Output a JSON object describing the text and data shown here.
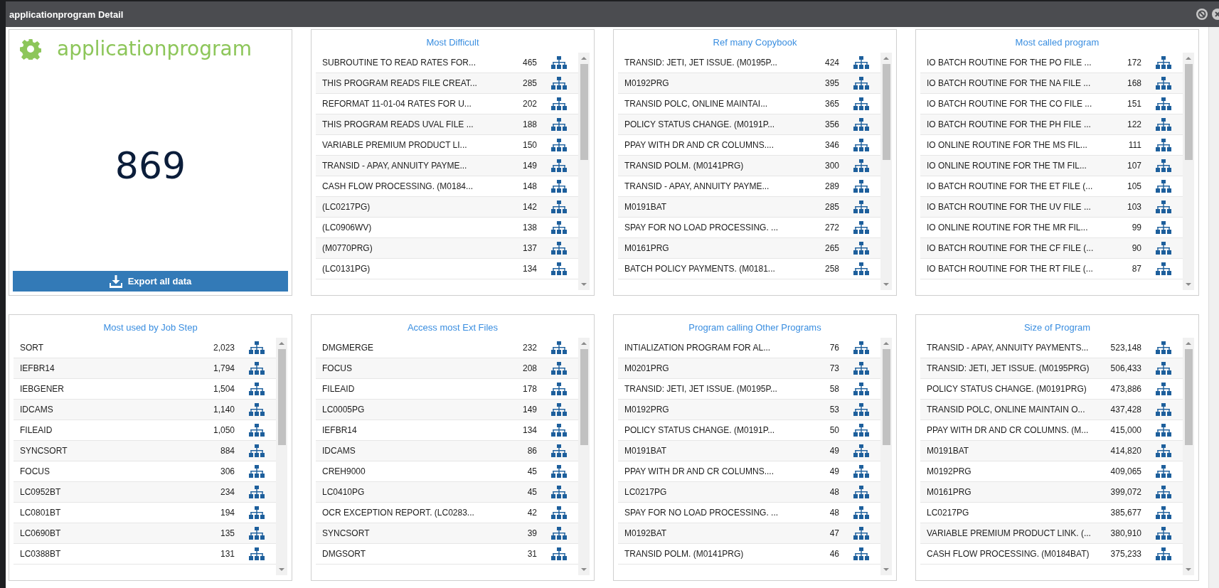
{
  "window": {
    "title": "applicationprogram Detail"
  },
  "summary": {
    "name": "applicationprogram",
    "count": "869",
    "export_button": "Export all data"
  },
  "panels": [
    {
      "title": "Most Difficult",
      "rows": [
        {
          "name": "SUBROUTINE TO READ RATES FOR...",
          "count": "465"
        },
        {
          "name": "THIS PROGRAM READS FILE CREAT...",
          "count": "285"
        },
        {
          "name": "REFORMAT 11-01-04 RATES FOR U...",
          "count": "202"
        },
        {
          "name": "THIS PROGRAM READS UVAL FILE ...",
          "count": "188"
        },
        {
          "name": "VARIABLE PREMIUM PRODUCT LI...",
          "count": "150"
        },
        {
          "name": "TRANSID - APAY, ANNUITY PAYME...",
          "count": "149"
        },
        {
          "name": "CASH FLOW PROCESSING. (M0184...",
          "count": "148"
        },
        {
          "name": "(LC0217PG)",
          "count": "142"
        },
        {
          "name": "(LC0906WV)",
          "count": "138"
        },
        {
          "name": "(M0770PRG)",
          "count": "137"
        },
        {
          "name": "(LC0131PG)",
          "count": "134"
        }
      ]
    },
    {
      "title": "Ref many Copybook",
      "rows": [
        {
          "name": "TRANSID: JETI, JET ISSUE. (M0195P...",
          "count": "424"
        },
        {
          "name": "M0192PRG",
          "count": "395"
        },
        {
          "name": "TRANSID POLC, ONLINE MAINTAI...",
          "count": "365"
        },
        {
          "name": "POLICY STATUS CHANGE. (M0191P...",
          "count": "356"
        },
        {
          "name": "PPAY WITH DR AND CR COLUMNS....",
          "count": "346"
        },
        {
          "name": "TRANSID POLM. (M0141PRG)",
          "count": "300"
        },
        {
          "name": "TRANSID - APAY, ANNUITY PAYME...",
          "count": "289"
        },
        {
          "name": "M0191BAT",
          "count": "285"
        },
        {
          "name": "SPAY FOR NO LOAD PROCESSING. ...",
          "count": "272"
        },
        {
          "name": "M0161PRG",
          "count": "265"
        },
        {
          "name": "BATCH POLICY PAYMENTS. (M0181...",
          "count": "258"
        }
      ]
    },
    {
      "title": "Most called program",
      "rows": [
        {
          "name": "IO BATCH ROUTINE FOR THE PO FILE ...",
          "count": "172"
        },
        {
          "name": "IO BATCH ROUTINE FOR THE NA FILE ...",
          "count": "168"
        },
        {
          "name": "IO BATCH ROUTINE FOR THE CO FILE ...",
          "count": "151"
        },
        {
          "name": "IO BATCH ROUTINE FOR THE PH FILE ...",
          "count": "122"
        },
        {
          "name": "IO ONLINE ROUTINE FOR THE MS FIL...",
          "count": "111"
        },
        {
          "name": "IO ONLINE ROUTINE FOR THE TM FIL...",
          "count": "107"
        },
        {
          "name": "IO BATCH ROUTINE FOR THE ET FILE (...",
          "count": "105"
        },
        {
          "name": "IO BATCH ROUTINE FOR THE UV FILE ...",
          "count": "103"
        },
        {
          "name": "IO ONLINE ROUTINE FOR THE MR FIL...",
          "count": "99"
        },
        {
          "name": "IO BATCH ROUTINE FOR THE CF FILE (...",
          "count": "90"
        },
        {
          "name": "IO BATCH ROUTINE FOR THE RT FILE (...",
          "count": "87"
        }
      ]
    },
    {
      "title": "Most used by Job Step",
      "rows": [
        {
          "name": "SORT",
          "count": "2,023"
        },
        {
          "name": "IEFBR14",
          "count": "1,794"
        },
        {
          "name": "IEBGENER",
          "count": "1,504"
        },
        {
          "name": "IDCAMS",
          "count": "1,140"
        },
        {
          "name": "FILEAID",
          "count": "1,050"
        },
        {
          "name": "SYNCSORT",
          "count": "884"
        },
        {
          "name": "FOCUS",
          "count": "306"
        },
        {
          "name": "LC0952BT",
          "count": "234"
        },
        {
          "name": "LC0801BT",
          "count": "194"
        },
        {
          "name": "LC0690BT",
          "count": "135"
        },
        {
          "name": "LC0388BT",
          "count": "131"
        }
      ]
    },
    {
      "title": "Access most Ext Files",
      "rows": [
        {
          "name": "DMGMERGE",
          "count": "232"
        },
        {
          "name": "FOCUS",
          "count": "208"
        },
        {
          "name": "FILEAID",
          "count": "178"
        },
        {
          "name": "LC0005PG",
          "count": "149"
        },
        {
          "name": "IEFBR14",
          "count": "134"
        },
        {
          "name": "IDCAMS",
          "count": "86"
        },
        {
          "name": "CREH9000",
          "count": "45"
        },
        {
          "name": "LC0410PG",
          "count": "45"
        },
        {
          "name": "OCR EXCEPTION REPORT. (LC0283...",
          "count": "42"
        },
        {
          "name": "SYNCSORT",
          "count": "39"
        },
        {
          "name": "DMGSORT",
          "count": "31"
        }
      ]
    },
    {
      "title": "Program calling Other Programs",
      "rows": [
        {
          "name": "INTIALIZATION PROGRAM FOR AL...",
          "count": "76"
        },
        {
          "name": "M0201PRG",
          "count": "73"
        },
        {
          "name": "TRANSID: JETI, JET ISSUE. (M0195P...",
          "count": "58"
        },
        {
          "name": "M0192PRG",
          "count": "53"
        },
        {
          "name": "POLICY STATUS CHANGE. (M0191P...",
          "count": "50"
        },
        {
          "name": "M0191BAT",
          "count": "49"
        },
        {
          "name": "PPAY WITH DR AND CR COLUMNS....",
          "count": "49"
        },
        {
          "name": "LC0217PG",
          "count": "48"
        },
        {
          "name": "SPAY FOR NO LOAD PROCESSING. ...",
          "count": "48"
        },
        {
          "name": "M0192BAT",
          "count": "47"
        },
        {
          "name": "TRANSID POLM. (M0141PRG)",
          "count": "46"
        }
      ]
    },
    {
      "title": "Size of Program",
      "rows": [
        {
          "name": "TRANSID - APAY, ANNUITY PAYMENTS...",
          "count": "523,148"
        },
        {
          "name": "TRANSID: JETI, JET ISSUE. (M0195PRG)",
          "count": "506,433"
        },
        {
          "name": "POLICY STATUS CHANGE. (M0191PRG)",
          "count": "473,886"
        },
        {
          "name": "TRANSID POLC, ONLINE MAINTAIN O...",
          "count": "437,428"
        },
        {
          "name": "PPAY WITH DR AND CR COLUMNS. (M...",
          "count": "415,000"
        },
        {
          "name": "M0191BAT",
          "count": "414,820"
        },
        {
          "name": "M0192PRG",
          "count": "409,065"
        },
        {
          "name": "M0161PRG",
          "count": "399,072"
        },
        {
          "name": "LC0217PG",
          "count": "385,677"
        },
        {
          "name": "VARIABLE PREMIUM PRODUCT LINK. (...",
          "count": "380,910"
        },
        {
          "name": "CASH FLOW PROCESSING. (M0184BAT)",
          "count": "375,233"
        }
      ]
    }
  ]
}
